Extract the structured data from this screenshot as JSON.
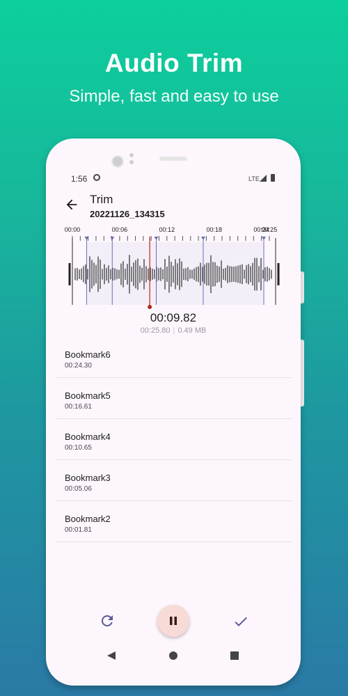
{
  "promo": {
    "title": "Audio Trim",
    "subtitle": "Simple, fast and easy to use"
  },
  "status_bar": {
    "time": "1:56",
    "network": "LTE"
  },
  "header": {
    "title": "Trim",
    "filename": "20221126_134315"
  },
  "timeline": {
    "tick_labels": [
      "00:00",
      "00:06",
      "00:12",
      "00:18",
      "00:24",
      "00:25"
    ],
    "duration_seconds": 25.8,
    "playhead_seconds": 9.82,
    "bookmark_seconds": [
      1.81,
      5.06,
      10.65,
      16.61,
      24.3
    ],
    "colors": {
      "waveform": "#3a3a3a",
      "playhead": "#b3261e",
      "bookmark_marker": "#6b6fb0",
      "selection": "#f3eef7"
    }
  },
  "playback": {
    "current": "00:09.82",
    "duration": "00:25.80",
    "separator": "|",
    "size": "0.49 MB"
  },
  "bookmarks": [
    {
      "name": "Bookmark6",
      "time": "00:24.30"
    },
    {
      "name": "Bookmark5",
      "time": "00:16.61"
    },
    {
      "name": "Bookmark4",
      "time": "00:10.65"
    },
    {
      "name": "Bookmark3",
      "time": "00:05.06"
    },
    {
      "name": "Bookmark2",
      "time": "00:01.81"
    }
  ],
  "controls": {
    "reset_icon": "reset-icon",
    "pause_icon": "pause-icon",
    "confirm_icon": "check-icon",
    "accent": "#5a5a9a",
    "pause_bg": "#f8dad6"
  },
  "nav_bar": {
    "back_icon": "triangle-back-icon",
    "home_icon": "circle-home-icon",
    "recents_icon": "square-recents-icon"
  }
}
